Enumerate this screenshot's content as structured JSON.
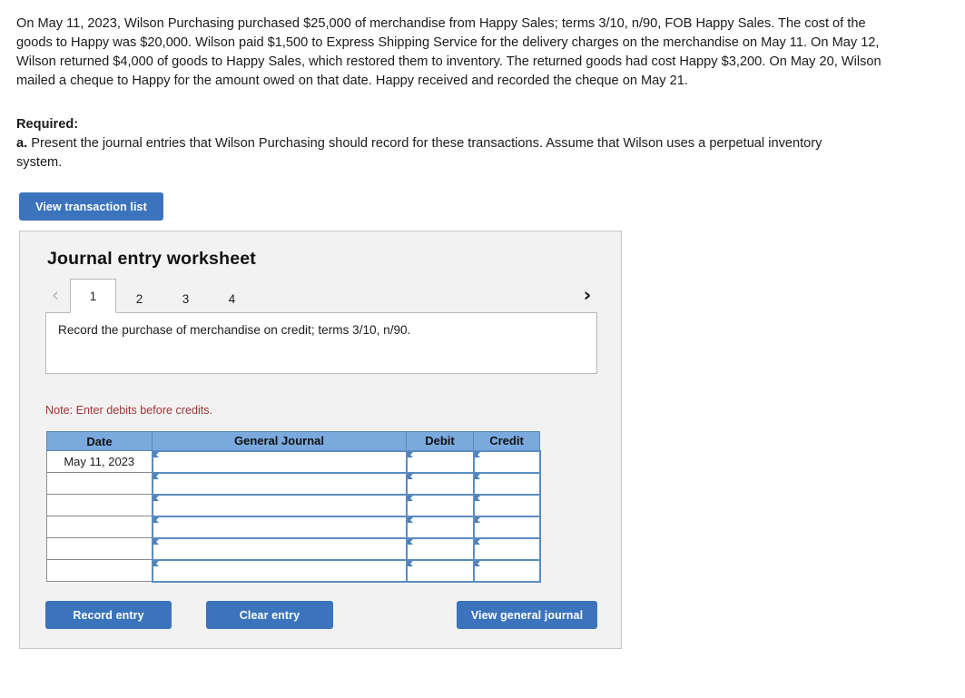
{
  "problem": {
    "text": "On May 11, 2023, Wilson Purchasing purchased $25,000 of merchandise from Happy Sales; terms 3/10, n/90, FOB Happy Sales. The cost of the goods to Happy was $20,000. Wilson paid $1,500 to Express Shipping Service for the delivery charges on the merchandise on May 11. On May 12, Wilson returned $4,000 of goods to Happy Sales, which restored them to inventory. The returned goods had cost Happy $3,200. On May 20, Wilson mailed a cheque to Happy for the amount owed on that date. Happy received and recorded the cheque on May 21."
  },
  "required": {
    "title": "Required:",
    "letter": "a.",
    "text": " Present the journal entries that Wilson Purchasing should record for these transactions. Assume that Wilson uses a perpetual inventory system."
  },
  "buttons": {
    "view_transaction_list": "View transaction list",
    "record_entry": "Record entry",
    "clear_entry": "Clear entry",
    "view_general_journal": "View general journal"
  },
  "worksheet": {
    "title": "Journal entry worksheet",
    "nav": {
      "prev_icon": "‹",
      "next_icon": "›",
      "prev_enabled": false,
      "next_enabled": true
    },
    "tabs": [
      {
        "label": "1",
        "active": true
      },
      {
        "label": "2",
        "active": false
      },
      {
        "label": "3",
        "active": false
      },
      {
        "label": "4",
        "active": false
      }
    ],
    "description": "Record the purchase of merchandise on credit; terms 3/10, n/90.",
    "note": "Note: Enter debits before credits."
  },
  "journal_table": {
    "headers": [
      "Date",
      "General Journal",
      "Debit",
      "Credit"
    ],
    "rows": [
      {
        "date": "May 11, 2023",
        "general_journal": "",
        "debit": "",
        "credit": ""
      },
      {
        "date": "",
        "general_journal": "",
        "debit": "",
        "credit": ""
      },
      {
        "date": "",
        "general_journal": "",
        "debit": "",
        "credit": ""
      },
      {
        "date": "",
        "general_journal": "",
        "debit": "",
        "credit": ""
      },
      {
        "date": "",
        "general_journal": "",
        "debit": "",
        "credit": ""
      },
      {
        "date": "",
        "general_journal": "",
        "debit": "",
        "credit": ""
      }
    ]
  },
  "colors": {
    "button_blue": "#3b74bc",
    "table_header_blue": "#7aa9dd",
    "cell_border_blue": "#5b8cc0",
    "note_red": "#a33236",
    "panel_bg": "#f2f2f2"
  }
}
